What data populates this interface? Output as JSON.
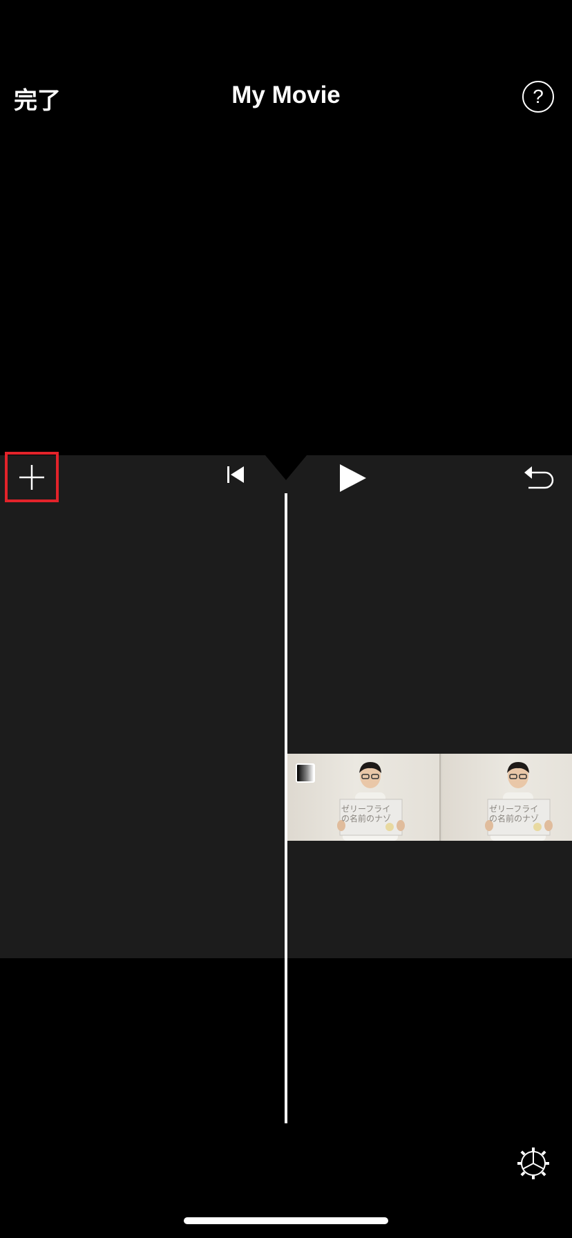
{
  "header": {
    "done_label": "完了",
    "title": "My Movie",
    "help_label": "?"
  },
  "timeline": {
    "clip": {
      "thumbnails": [
        {
          "sign_text": "ゼリーフライの名前のナゾ"
        },
        {
          "sign_text": "ゼリーフライの名前のナゾ"
        }
      ]
    }
  },
  "icons": {
    "add": "plus-icon",
    "skip_back": "skip-to-start-icon",
    "play": "play-icon",
    "undo": "undo-icon",
    "help": "question-mark-icon",
    "settings": "gear-icon",
    "transition": "transition-icon"
  },
  "colors": {
    "highlight": "#e2232a",
    "timeline_bg": "#1c1c1c",
    "background": "#000000"
  }
}
